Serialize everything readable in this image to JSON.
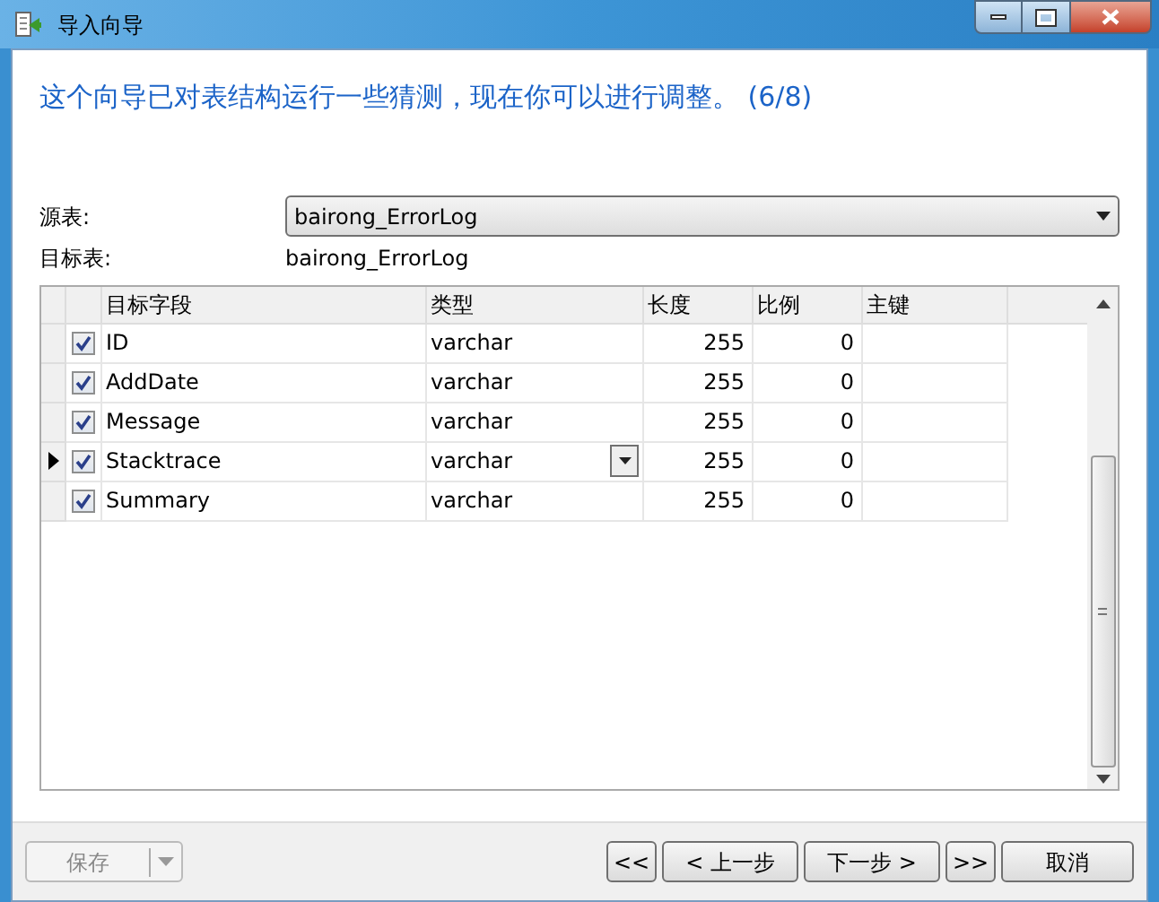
{
  "window": {
    "title": "导入向导"
  },
  "heading": "这个向导已对表结构运行一些猜测，现在你可以进行调整。 (6/8)",
  "source_table": {
    "label": "源表:",
    "value": "bairong_ErrorLog"
  },
  "target_table": {
    "label": "目标表:",
    "value": "bairong_ErrorLog"
  },
  "table": {
    "columns": [
      "目标字段",
      "类型",
      "长度",
      "比例",
      "主键"
    ],
    "rows": [
      {
        "checked": true,
        "selected": false,
        "cells": [
          "ID",
          "varchar",
          "255",
          "0",
          ""
        ]
      },
      {
        "checked": true,
        "selected": false,
        "cells": [
          "AddDate",
          "varchar",
          "255",
          "0",
          ""
        ]
      },
      {
        "checked": true,
        "selected": false,
        "cells": [
          "Message",
          "varchar",
          "255",
          "0",
          ""
        ]
      },
      {
        "checked": true,
        "selected": true,
        "cells": [
          "Stacktrace",
          "varchar",
          "255",
          "0",
          ""
        ]
      },
      {
        "checked": true,
        "selected": false,
        "cells": [
          "Summary",
          "varchar",
          "255",
          "0",
          ""
        ]
      }
    ]
  },
  "footer": {
    "save": {
      "label": "保存",
      "disabled": true
    },
    "buttons": [
      "<<",
      "< 上一步",
      "下一步 >",
      ">>",
      "取消"
    ]
  }
}
